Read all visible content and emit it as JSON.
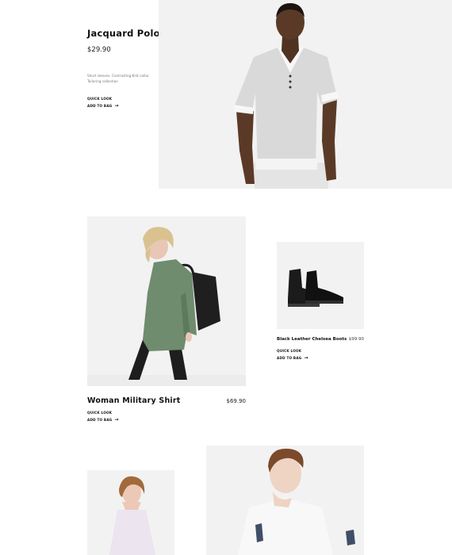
{
  "products": {
    "polo": {
      "title": "Jacquard Polo Shirt",
      "price": "$29.90",
      "desc_line1": "Short sleeves. Contrasting Knit collar.",
      "desc_line2": "Tailoring collection",
      "quick_look": "Quick look",
      "add_to_bag": "Add to bag"
    },
    "military": {
      "title": "Woman Military Shirt",
      "price": "$69.90",
      "quick_look": "Quick look",
      "add_to_bag": "Add to bag"
    },
    "boots": {
      "title": "Black Leather Chelsea Boots",
      "price": "$99.90",
      "quick_look": "Quick look",
      "add_to_bag": "Add to bag"
    }
  },
  "icons": {
    "arrow": "arrow-right-icon"
  },
  "colors": {
    "background": "#ffffff",
    "image_bg": "#f1f1f1",
    "text": "#111111",
    "muted": "#777777"
  }
}
